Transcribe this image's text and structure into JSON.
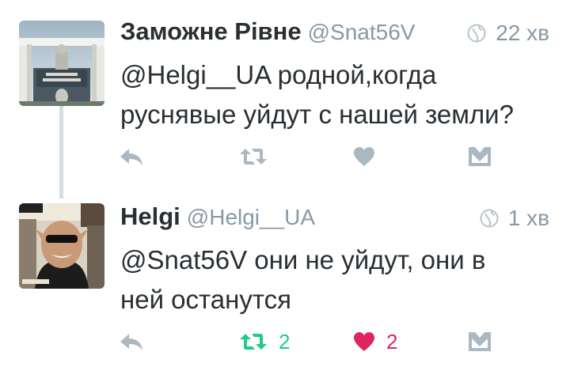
{
  "tweets": [
    {
      "name": "Заможне Рівне",
      "handle": "@Snat56V",
      "time": "22 хв",
      "text_lines": [
        "@Helgi__UA родной,когда",
        "руснявые уйдут с нашей земли?"
      ],
      "retweet_count": "",
      "like_count": "",
      "retweeted": false,
      "liked": false
    },
    {
      "name": "Helgi",
      "handle": "@Helgi__UA",
      "time": "1 хв",
      "text_lines": [
        "@Snat56V они не уйдут, они в",
        "ней останутся"
      ],
      "retweet_count": "2",
      "like_count": "2",
      "retweeted": true,
      "liked": true
    }
  ],
  "colors": {
    "text": "#292f33",
    "muted": "#8899a6",
    "icon": "#aab8c2",
    "retweet_active": "#19cf86",
    "like_active": "#e0245e",
    "thread_line": "#d3dee6"
  },
  "icons": [
    "reply-icon",
    "retweet-icon",
    "like-icon",
    "dm-icon",
    "globe-icon"
  ]
}
